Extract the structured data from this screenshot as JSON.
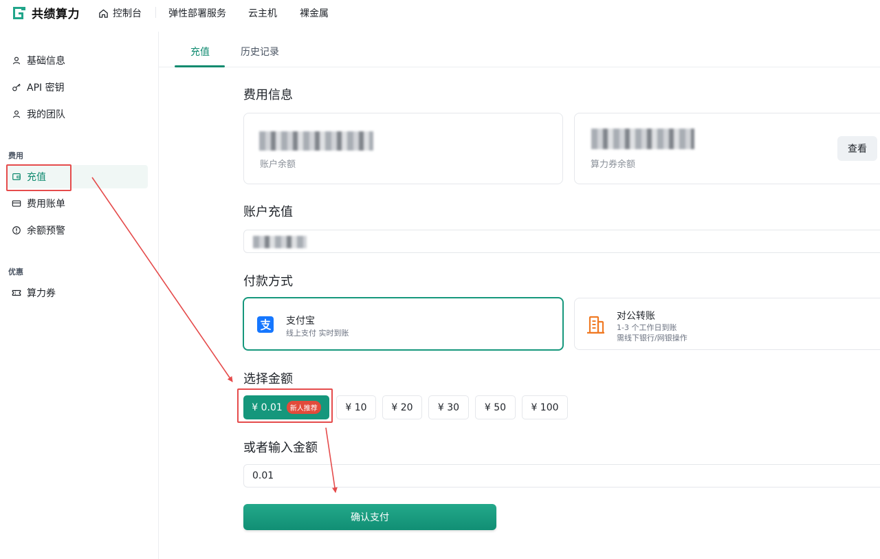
{
  "brand": {
    "name": "共绩算力",
    "color": "#0e8a6f"
  },
  "topnav": [
    {
      "label": "控制台",
      "icon": "home-icon"
    },
    {
      "label": "弹性部署服务"
    },
    {
      "label": "云主机"
    },
    {
      "label": "裸金属"
    }
  ],
  "sidebar": {
    "items": [
      {
        "label": "基础信息",
        "icon": "user-icon"
      },
      {
        "label": "API 密钥",
        "icon": "key-icon"
      },
      {
        "label": "我的团队",
        "icon": "team-icon"
      }
    ],
    "group_fee": "费用",
    "fee_items": [
      {
        "label": "充值",
        "icon": "wallet-icon",
        "active": true
      },
      {
        "label": "费用账单",
        "icon": "card-icon"
      },
      {
        "label": "余额预警",
        "icon": "alert-icon"
      }
    ],
    "group_promo": "优惠",
    "promo_items": [
      {
        "label": "算力券",
        "icon": "ticket-icon"
      }
    ]
  },
  "tabs": [
    {
      "label": "充值",
      "active": true
    },
    {
      "label": "历史记录"
    }
  ],
  "fee_info": {
    "title": "费用信息",
    "account_balance_label": "账户余额",
    "voucher_balance_label": "算力券余额",
    "view_button": "查看"
  },
  "recharge": {
    "title": "账户充值"
  },
  "payment": {
    "title": "付款方式",
    "methods": [
      {
        "name": "支付宝",
        "desc": "线上支付 实时到账",
        "icon": "alipay-icon",
        "selected": true
      },
      {
        "name": "对公转账",
        "desc1": "1-3 个工作日到账",
        "desc2": "需线下银行/网银操作",
        "icon": "building-icon"
      }
    ]
  },
  "amount": {
    "title": "选择金额",
    "options": [
      {
        "label": "¥ 0.01",
        "badge": "新人推荐",
        "selected": true
      },
      {
        "label": "¥ 10"
      },
      {
        "label": "¥ 20"
      },
      {
        "label": "¥ 30"
      },
      {
        "label": "¥ 50"
      },
      {
        "label": "¥ 100"
      }
    ]
  },
  "custom_amount": {
    "title": "或者输入金额",
    "value": "0.01"
  },
  "confirm_button": "确认支付",
  "colors": {
    "accent": "#15977c",
    "annotation": "#e54b4b",
    "badge": "#e24b3b"
  }
}
